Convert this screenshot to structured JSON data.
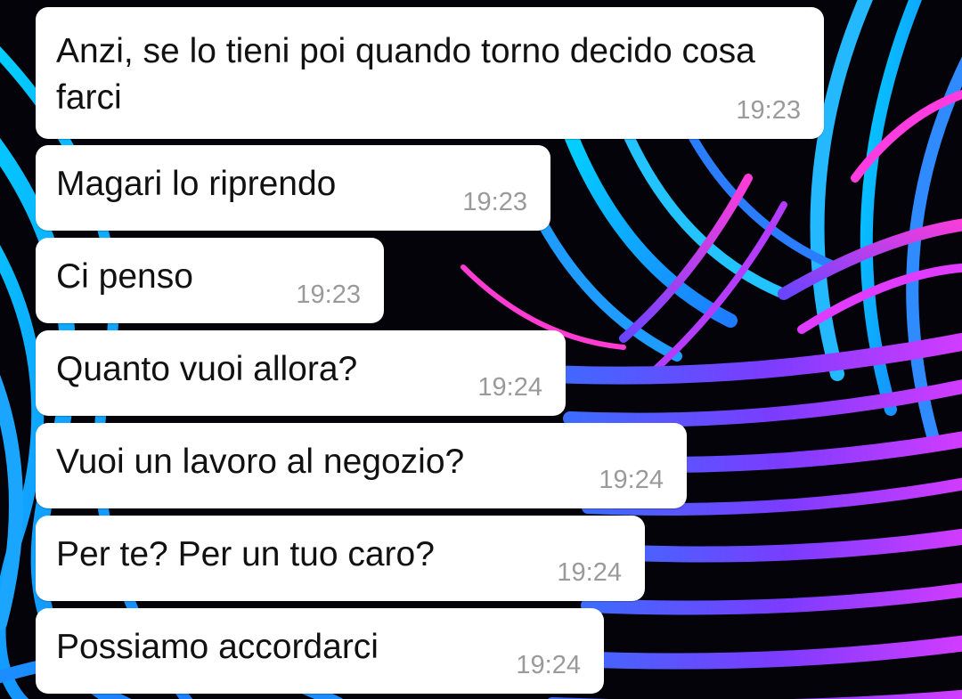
{
  "wallpaper": {
    "description_colors": [
      "#00c8ff",
      "#2a6bff",
      "#7a3cff",
      "#d43cff",
      "#05030a"
    ]
  },
  "messages": [
    {
      "text": "Anzi, se lo tieni poi quando torno decido cosa farci",
      "time": "19:23"
    },
    {
      "text": "Magari lo riprendo",
      "time": "19:23"
    },
    {
      "text": "Ci penso",
      "time": "19:23"
    },
    {
      "text": "Quanto vuoi allora?",
      "time": "19:24"
    },
    {
      "text": "Vuoi un lavoro al negozio?",
      "time": "19:24"
    },
    {
      "text": "Per te? Per un tuo caro?",
      "time": "19:24"
    },
    {
      "text": "Possiamo accordarci",
      "time": "19:24"
    }
  ]
}
